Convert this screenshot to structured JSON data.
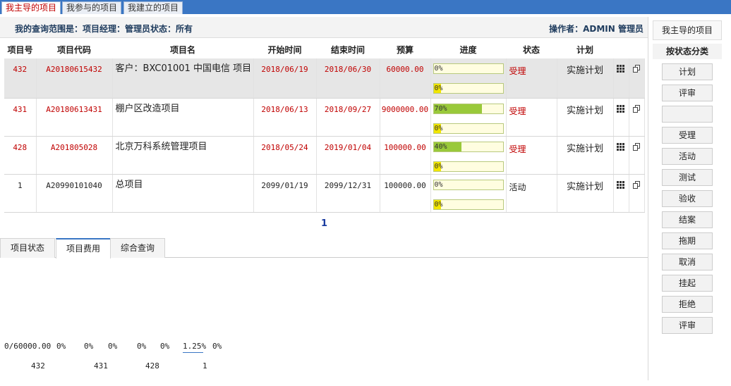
{
  "top_tabs": [
    {
      "label": "我主导的项目",
      "active": true
    },
    {
      "label": "我参与的项目",
      "active": false
    },
    {
      "label": "我建立的项目",
      "active": false
    }
  ],
  "query": {
    "scope": "我的查询范围是：项目经理：管理员状态：所有",
    "operator": "操作者：ADMIN 管理员"
  },
  "table": {
    "headers": [
      "项目号",
      "项目代码",
      "项目名",
      "开始时间",
      "结束时间",
      "预算",
      "进度",
      "状态",
      "计划",
      "",
      ""
    ],
    "rows": [
      {
        "id": "432",
        "code": "A20180615432",
        "name": "客户：BXC01001 中国电信 项目",
        "start": "2018/06/19",
        "end": "2018/06/30",
        "budget": "60000.00",
        "progress": 0.0,
        "progress_label": "0%",
        "progress2_label": "0%",
        "status": "受理",
        "plan": "实施计划",
        "highlight": true,
        "red": true
      },
      {
        "id": "431",
        "code": "A20180613431",
        "name": "棚户区改造项目",
        "start": "2018/06/13",
        "end": "2018/09/27",
        "budget": "9000000.00",
        "progress": 0.7,
        "progress_label": "70%",
        "progress2_label": "0%",
        "status": "受理",
        "plan": "实施计划",
        "highlight": false,
        "red": true
      },
      {
        "id": "428",
        "code": "A201805028",
        "name": "北京万科系统管理项目",
        "start": "2018/05/24",
        "end": "2019/01/04",
        "budget": "100000.00",
        "progress": 0.4,
        "progress_label": "40%",
        "progress2_label": "0%",
        "status": "受理",
        "plan": "实施计划",
        "highlight": false,
        "red": true
      },
      {
        "id": "1",
        "code": "A20990101040",
        "name": "总项目",
        "start": "2099/01/19",
        "end": "2099/12/31",
        "budget": "100000.00",
        "progress": 0.0,
        "progress_label": "0%",
        "progress2_label": "0%",
        "status": "活动",
        "plan": "实施计划",
        "highlight": false,
        "red": false
      }
    ]
  },
  "pager": {
    "current": "1"
  },
  "bottom_tabs": [
    {
      "label": "项目状态",
      "active": false
    },
    {
      "label": "项目费用",
      "active": true
    },
    {
      "label": "综合查询",
      "active": false
    }
  ],
  "chart_row1": [
    "0/60000.00",
    "0%",
    "0%",
    "0%",
    "0%",
    "0%",
    "1.25%",
    "0%"
  ],
  "chart_row2": [
    "432",
    "431",
    "428",
    "1"
  ],
  "right_panel": {
    "header": "我主导的项目",
    "subheader": "按状态分类",
    "buttons": [
      "计划",
      "评审",
      "",
      "受理",
      "活动",
      "测试",
      "验收",
      "结案",
      "拖期",
      "取消",
      "挂起",
      "拒绝",
      "评审"
    ]
  }
}
